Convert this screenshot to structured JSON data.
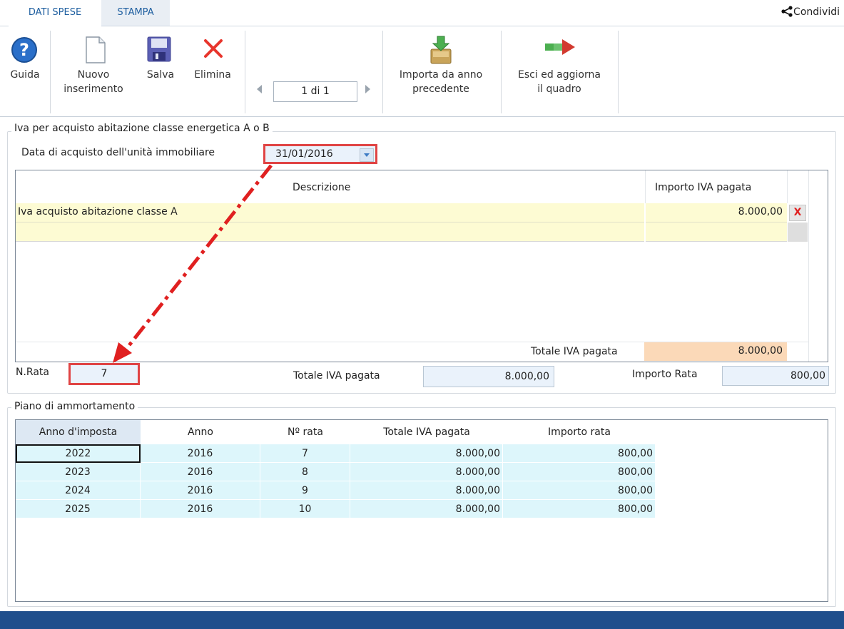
{
  "tabs": {
    "active": "DATI SPESE",
    "inactive": "STAMPA"
  },
  "share": {
    "label": "Condividi",
    "icon": "share-icon"
  },
  "toolbar": {
    "guida": "Guida",
    "nuovo_line1": "Nuovo",
    "nuovo_line2": "inserimento",
    "salva": "Salva",
    "elimina": "Elimina",
    "pager": "1 di 1",
    "importa_line1": "Importa da anno",
    "importa_line2": "precedente",
    "esci_line1": "Esci ed aggiorna",
    "esci_line2": "il quadro"
  },
  "section1": {
    "legend": "Iva per acquisto abitazione classe energetica A o B",
    "date_label": "Data di acquisto dell'unità immobiliare",
    "date_value": "31/01/2016",
    "col_desc": "Descrizione",
    "col_importo": "Importo IVA pagata",
    "rows": [
      {
        "desc": "Iva acquisto abitazione classe A",
        "importo": "8.000,00",
        "delete": "X"
      },
      {
        "desc": "",
        "importo": ""
      }
    ],
    "total_label": "Totale IVA pagata",
    "total_value": "8.000,00",
    "nrata_label": "N.Rata",
    "nrata_value": "7",
    "totale_label": "Totale IVA pagata",
    "totale_value": "8.000,00",
    "importo_rata_label": "Importo Rata",
    "importo_rata_value": "800,00"
  },
  "section2": {
    "legend": "Piano di ammortamento",
    "headers": [
      "Anno d'imposta",
      "Anno",
      "Nº rata",
      "Totale IVA pagata",
      "Importo rata"
    ],
    "rows": [
      [
        "2022",
        "2016",
        "7",
        "8.000,00",
        "800,00"
      ],
      [
        "2023",
        "2016",
        "8",
        "8.000,00",
        "800,00"
      ],
      [
        "2024",
        "2016",
        "9",
        "8.000,00",
        "800,00"
      ],
      [
        "2025",
        "2016",
        "10",
        "8.000,00",
        "800,00"
      ]
    ]
  },
  "colors": {
    "accent": "#1f5fa0",
    "annotation": "#e02020",
    "bottom_bar": "#1f4e8c",
    "row_bg": "#ddf6fb"
  }
}
